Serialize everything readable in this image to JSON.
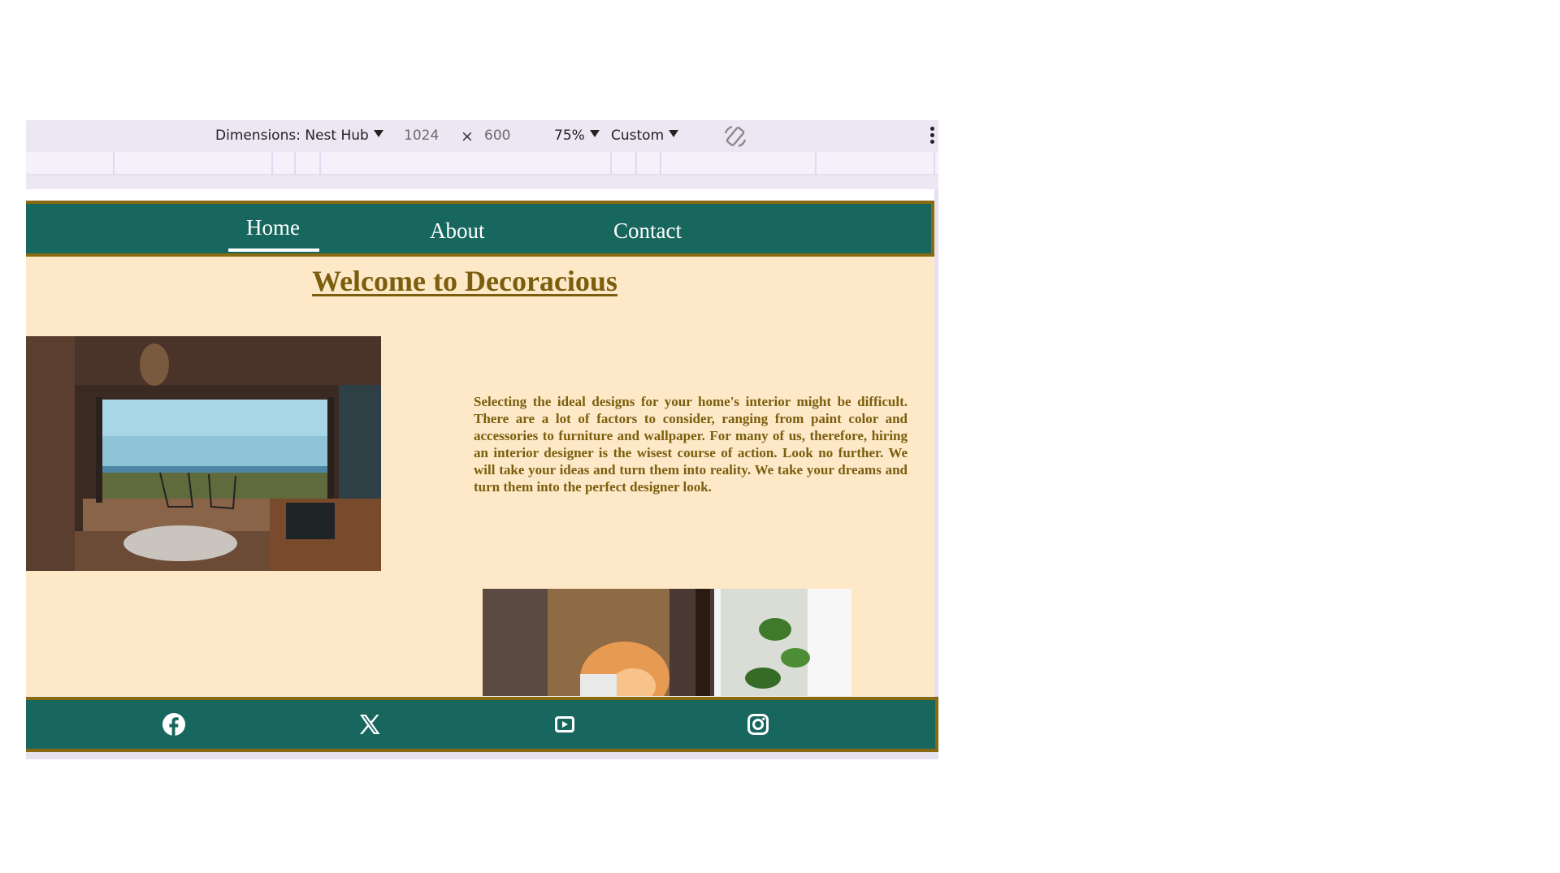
{
  "devtools": {
    "dimensions_label": "Dimensions: Nest Hub",
    "width_value": "1024",
    "times_symbol": "×",
    "height_value": "600",
    "zoom_label": "75%",
    "throttle_label": "Custom"
  },
  "site": {
    "nav": {
      "home": "Home",
      "about": "About",
      "contact": "Contact"
    },
    "title": "Welcome to Decoracious",
    "intro": "Selecting the ideal designs for your home's interior might be difficult. There are a lot of factors to consider, ranging from paint color and accessories to furniture and wallpaper. For many of us, therefore, hiring an interior designer is the wisest course of action. Look no further. We will take your ideas and turn them into reality. We take your dreams and turn them into the perfect designer look.",
    "footer_icons": [
      "facebook-icon",
      "x-twitter-icon",
      "youtube-icon",
      "instagram-icon"
    ]
  },
  "colors": {
    "nav_bg": "#17675e",
    "border_gold": "#8a6a10",
    "page_bg": "#fde8c8",
    "heading": "#7b5e0d"
  }
}
